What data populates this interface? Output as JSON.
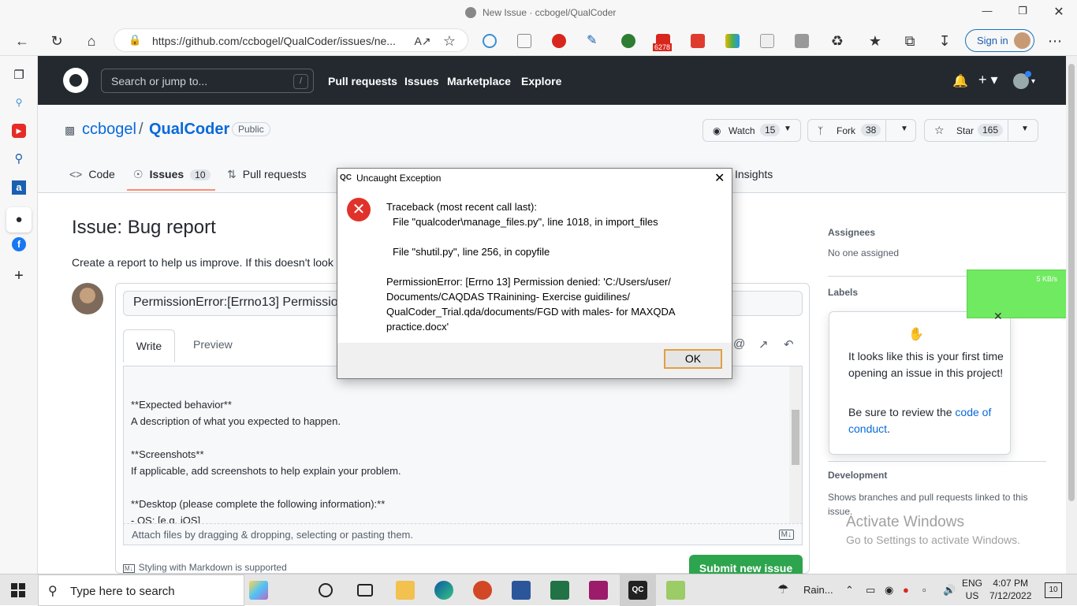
{
  "window": {
    "title": "New Issue · ccbogel/QualCoder"
  },
  "browser": {
    "url": "https://github.com/ccbogel/QualCoder/issues/ne...",
    "mail_badge": "6278",
    "signin_label": "Sign in"
  },
  "gh_header": {
    "search_placeholder": "Search or jump to...",
    "search_key": "/",
    "nav": [
      "Pull requests",
      "Issues",
      "Marketplace",
      "Explore"
    ]
  },
  "repo": {
    "owner": "ccbogel",
    "separator": "/",
    "name": "QualCoder",
    "visibility": "Public",
    "watch_label": "Watch",
    "watch_count": "15",
    "fork_label": "Fork",
    "fork_count": "38",
    "star_label": "Star",
    "star_count": "165",
    "tabs": [
      {
        "label": "Code"
      },
      {
        "label": "Issues",
        "count": "10"
      },
      {
        "label": "Pull requests"
      },
      {
        "label": "Insights"
      }
    ]
  },
  "issue_form": {
    "heading": "Issue: Bug report",
    "description": "Create a report to help us improve. If this doesn't look",
    "title_value": "PermissionError:[Errno13] Permission",
    "write_tab": "Write",
    "preview_tab": "Preview",
    "body_lines": [
      "**Expected behavior**",
      "A description of what you expected to happen.",
      "",
      "**Screenshots**",
      "If applicable, add screenshots to help explain your problem.",
      "",
      "**Desktop (please complete the following information):**",
      " - OS: [e.g. iOS]"
    ],
    "attach_text": "Attach files by dragging & dropping, selecting or pasting them.",
    "markdown_note": "Styling with Markdown is supported",
    "submit_label": "Submit new issue"
  },
  "sidebar_right": {
    "assignees_heading": "Assignees",
    "assignees_value": "No one assigned",
    "labels_heading": "Labels",
    "development_heading": "Development",
    "development_text": "Shows branches and pull requests linked to this issue."
  },
  "popover": {
    "text1": "It looks like this is your first time opening an issue in this project!",
    "text2_prefix": "Be sure to review the ",
    "link": "code of conduct",
    "text2_suffix": "."
  },
  "speed_widget": {
    "rate": "5 KB/s"
  },
  "dialog": {
    "title": "Uncaught Exception",
    "lines": [
      "Traceback (most recent call last):",
      "  File \"qualcoder\\manage_files.py\", line 1018, in import_files",
      "",
      "  File \"shutil.py\", line 256, in copyfile",
      "",
      "PermissionError: [Errno 13] Permission denied: 'C:/Users/user/",
      "Documents/CAQDAS TRainining- Exercise guidilines/",
      "QualCoder_Trial.qda/documents/FGD with males- for MAXQDA",
      "practice.docx'"
    ],
    "ok_label": "OK"
  },
  "watermark": {
    "line1": "Activate Windows",
    "line2": "Go to Settings to activate Windows."
  },
  "taskbar": {
    "search_placeholder": "Type here to search",
    "weather": "Rain...",
    "lang1": "ENG",
    "lang2": "US",
    "time": "4:07 PM",
    "date": "7/12/2022",
    "notif_count": "10"
  }
}
